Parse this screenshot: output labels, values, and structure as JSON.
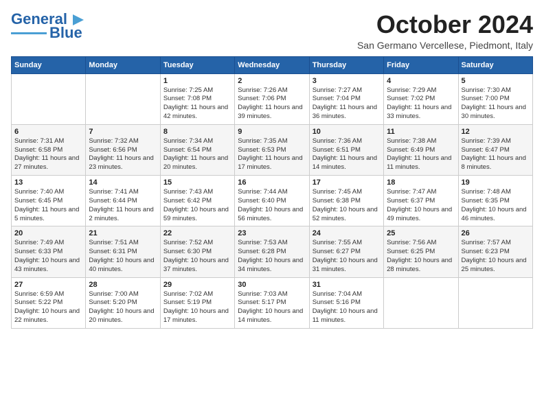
{
  "header": {
    "logo_text1": "General",
    "logo_text2": "Blue",
    "month": "October 2024",
    "location": "San Germano Vercellese, Piedmont, Italy"
  },
  "days_of_week": [
    "Sunday",
    "Monday",
    "Tuesday",
    "Wednesday",
    "Thursday",
    "Friday",
    "Saturday"
  ],
  "weeks": [
    [
      {
        "day": "",
        "info": ""
      },
      {
        "day": "",
        "info": ""
      },
      {
        "day": "1",
        "info": "Sunrise: 7:25 AM\nSunset: 7:08 PM\nDaylight: 11 hours and 42 minutes."
      },
      {
        "day": "2",
        "info": "Sunrise: 7:26 AM\nSunset: 7:06 PM\nDaylight: 11 hours and 39 minutes."
      },
      {
        "day": "3",
        "info": "Sunrise: 7:27 AM\nSunset: 7:04 PM\nDaylight: 11 hours and 36 minutes."
      },
      {
        "day": "4",
        "info": "Sunrise: 7:29 AM\nSunset: 7:02 PM\nDaylight: 11 hours and 33 minutes."
      },
      {
        "day": "5",
        "info": "Sunrise: 7:30 AM\nSunset: 7:00 PM\nDaylight: 11 hours and 30 minutes."
      }
    ],
    [
      {
        "day": "6",
        "info": "Sunrise: 7:31 AM\nSunset: 6:58 PM\nDaylight: 11 hours and 27 minutes."
      },
      {
        "day": "7",
        "info": "Sunrise: 7:32 AM\nSunset: 6:56 PM\nDaylight: 11 hours and 23 minutes."
      },
      {
        "day": "8",
        "info": "Sunrise: 7:34 AM\nSunset: 6:54 PM\nDaylight: 11 hours and 20 minutes."
      },
      {
        "day": "9",
        "info": "Sunrise: 7:35 AM\nSunset: 6:53 PM\nDaylight: 11 hours and 17 minutes."
      },
      {
        "day": "10",
        "info": "Sunrise: 7:36 AM\nSunset: 6:51 PM\nDaylight: 11 hours and 14 minutes."
      },
      {
        "day": "11",
        "info": "Sunrise: 7:38 AM\nSunset: 6:49 PM\nDaylight: 11 hours and 11 minutes."
      },
      {
        "day": "12",
        "info": "Sunrise: 7:39 AM\nSunset: 6:47 PM\nDaylight: 11 hours and 8 minutes."
      }
    ],
    [
      {
        "day": "13",
        "info": "Sunrise: 7:40 AM\nSunset: 6:45 PM\nDaylight: 11 hours and 5 minutes."
      },
      {
        "day": "14",
        "info": "Sunrise: 7:41 AM\nSunset: 6:44 PM\nDaylight: 11 hours and 2 minutes."
      },
      {
        "day": "15",
        "info": "Sunrise: 7:43 AM\nSunset: 6:42 PM\nDaylight: 10 hours and 59 minutes."
      },
      {
        "day": "16",
        "info": "Sunrise: 7:44 AM\nSunset: 6:40 PM\nDaylight: 10 hours and 56 minutes."
      },
      {
        "day": "17",
        "info": "Sunrise: 7:45 AM\nSunset: 6:38 PM\nDaylight: 10 hours and 52 minutes."
      },
      {
        "day": "18",
        "info": "Sunrise: 7:47 AM\nSunset: 6:37 PM\nDaylight: 10 hours and 49 minutes."
      },
      {
        "day": "19",
        "info": "Sunrise: 7:48 AM\nSunset: 6:35 PM\nDaylight: 10 hours and 46 minutes."
      }
    ],
    [
      {
        "day": "20",
        "info": "Sunrise: 7:49 AM\nSunset: 6:33 PM\nDaylight: 10 hours and 43 minutes."
      },
      {
        "day": "21",
        "info": "Sunrise: 7:51 AM\nSunset: 6:31 PM\nDaylight: 10 hours and 40 minutes."
      },
      {
        "day": "22",
        "info": "Sunrise: 7:52 AM\nSunset: 6:30 PM\nDaylight: 10 hours and 37 minutes."
      },
      {
        "day": "23",
        "info": "Sunrise: 7:53 AM\nSunset: 6:28 PM\nDaylight: 10 hours and 34 minutes."
      },
      {
        "day": "24",
        "info": "Sunrise: 7:55 AM\nSunset: 6:27 PM\nDaylight: 10 hours and 31 minutes."
      },
      {
        "day": "25",
        "info": "Sunrise: 7:56 AM\nSunset: 6:25 PM\nDaylight: 10 hours and 28 minutes."
      },
      {
        "day": "26",
        "info": "Sunrise: 7:57 AM\nSunset: 6:23 PM\nDaylight: 10 hours and 25 minutes."
      }
    ],
    [
      {
        "day": "27",
        "info": "Sunrise: 6:59 AM\nSunset: 5:22 PM\nDaylight: 10 hours and 22 minutes."
      },
      {
        "day": "28",
        "info": "Sunrise: 7:00 AM\nSunset: 5:20 PM\nDaylight: 10 hours and 20 minutes."
      },
      {
        "day": "29",
        "info": "Sunrise: 7:02 AM\nSunset: 5:19 PM\nDaylight: 10 hours and 17 minutes."
      },
      {
        "day": "30",
        "info": "Sunrise: 7:03 AM\nSunset: 5:17 PM\nDaylight: 10 hours and 14 minutes."
      },
      {
        "day": "31",
        "info": "Sunrise: 7:04 AM\nSunset: 5:16 PM\nDaylight: 10 hours and 11 minutes."
      },
      {
        "day": "",
        "info": ""
      },
      {
        "day": "",
        "info": ""
      }
    ]
  ]
}
